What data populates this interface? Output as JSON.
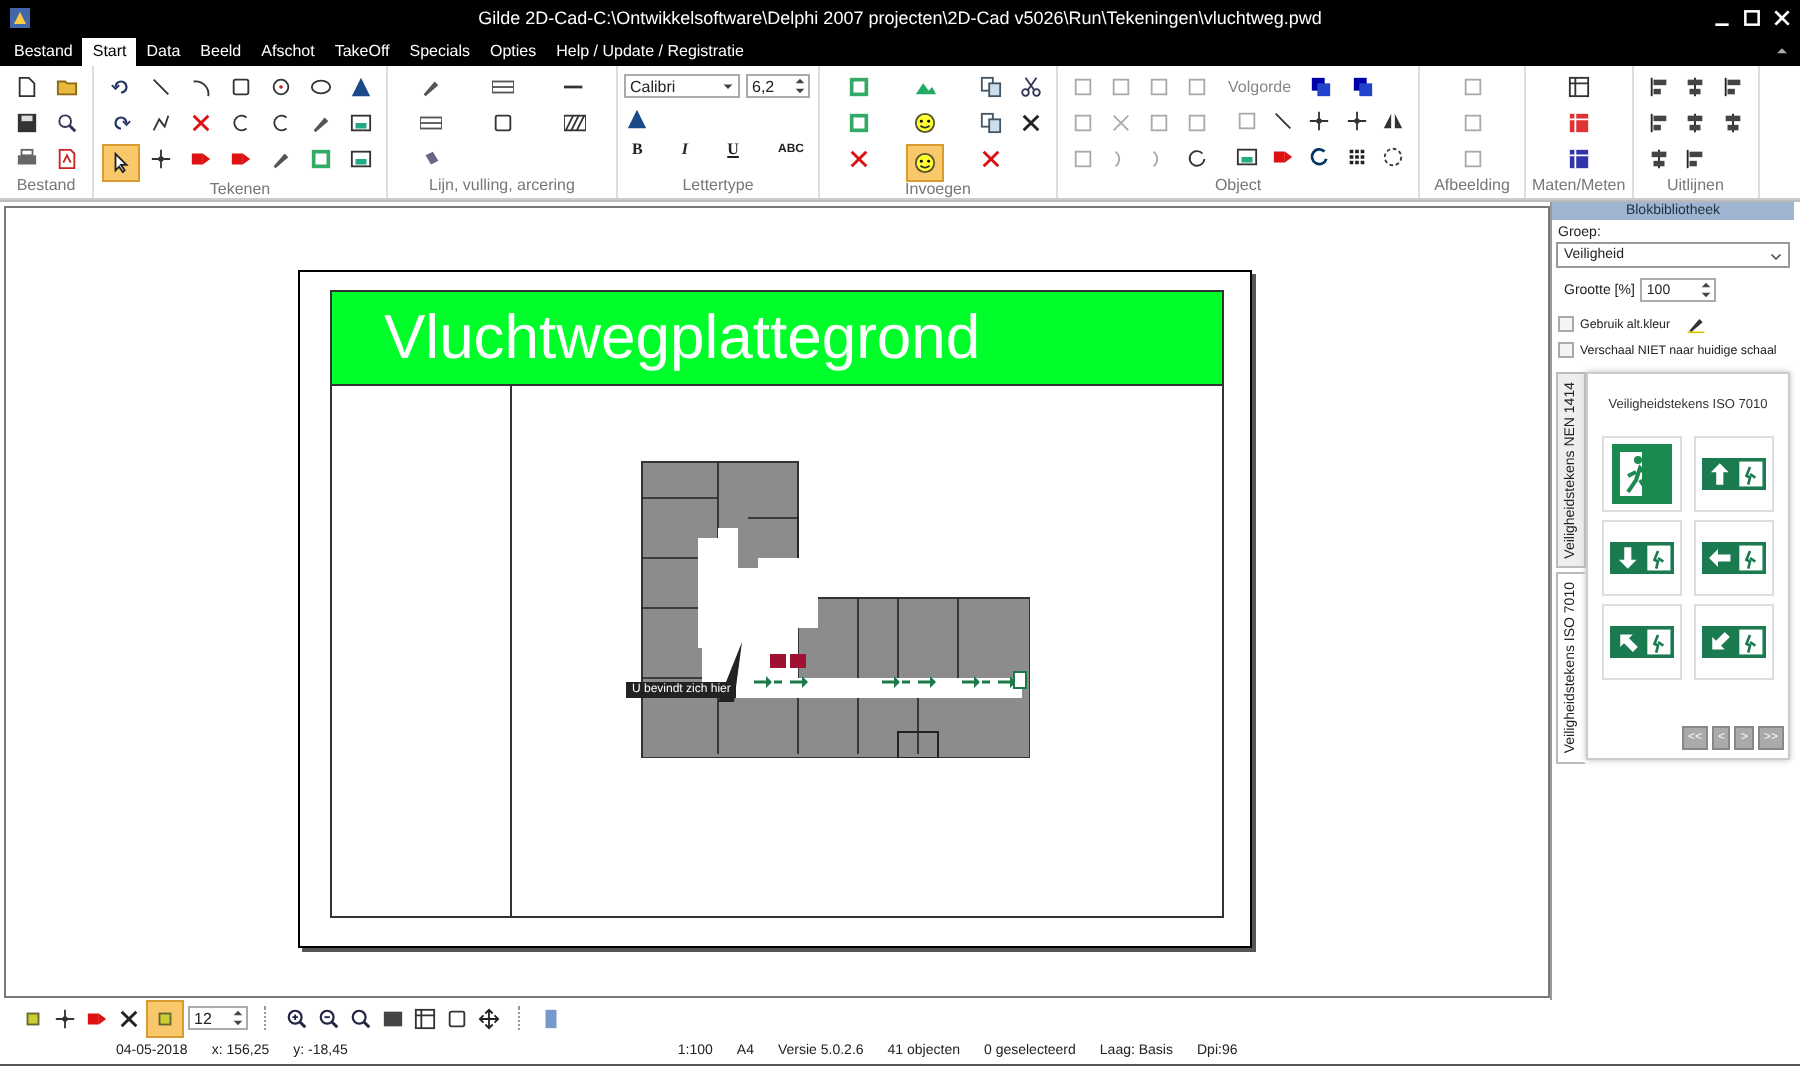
{
  "window": {
    "title": "Gilde  2D-Cad-C:\\Ontwikkelsoftware\\Delphi  2007  projecten\\2D-Cad  v5026\\Run\\Tekeningen\\vluchtweg.pwd"
  },
  "menu": [
    {
      "label": "Bestand",
      "selected": false
    },
    {
      "label": "Start",
      "selected": true
    },
    {
      "label": "Data",
      "selected": false
    },
    {
      "label": "Beeld",
      "selected": false
    },
    {
      "label": "Afschot",
      "selected": false
    },
    {
      "label": "TakeOff",
      "selected": false
    },
    {
      "label": "Specials",
      "selected": false
    },
    {
      "label": "Opties",
      "selected": false
    },
    {
      "label": "Help / Update / Registratie",
      "selected": false
    }
  ],
  "ribbon": {
    "groups": [
      {
        "kind": "bestand",
        "label": "Bestand"
      },
      {
        "kind": "tekenen",
        "label": "Tekenen",
        "pointer_selected": true
      },
      {
        "kind": "lijn",
        "label": "Lijn, vulling, arcering"
      },
      {
        "kind": "lettertype",
        "label": "Lettertype"
      },
      {
        "kind": "invoegen",
        "label": "Invoegen",
        "smiley_selected": true
      },
      {
        "kind": "object",
        "label": "Object",
        "order_label": "Volgorde"
      },
      {
        "kind": "afbeelding",
        "label": "Afbeelding"
      },
      {
        "kind": "maten",
        "label": "Maten/Meten"
      },
      {
        "kind": "uitlijnen",
        "label": "Uitlijnen"
      }
    ],
    "font": {
      "value": "Calibri"
    },
    "font_size": {
      "value": "6,2"
    },
    "format_buttons": [
      "B",
      "I",
      "U",
      "ABC"
    ]
  },
  "canvas": {
    "title": "Vluchtwegplattegrond",
    "callout": "U bevindt zich hier"
  },
  "panel": {
    "title": "Blokbibliotheek",
    "group_label": "Groep:",
    "group_value": "Veiligheid",
    "size_label": "Grootte [%]",
    "size_value": "100",
    "checkboxes": [
      {
        "label": "Gebruik alt.kleur",
        "checked": false
      },
      {
        "label": "Verschaal NIET naar huidige schaal",
        "checked": false
      }
    ],
    "tabs": [
      {
        "label": "Veiligheidstekens NEN 1414",
        "selected": false
      },
      {
        "label": "Veiligheidstekens ISO 7010",
        "selected": true
      }
    ],
    "page_title": "Veiligheidstekens ISO 7010",
    "signs": [
      {
        "kind": "running"
      },
      {
        "kind": "up"
      },
      {
        "kind": "down"
      },
      {
        "kind": "left"
      },
      {
        "kind": "upleft"
      },
      {
        "kind": "downleft"
      }
    ],
    "nav": [
      "<<",
      "<",
      ">",
      ">>"
    ]
  },
  "bottom_toolbar": {
    "snap_selected": true,
    "grid_value": "12"
  },
  "status_bar": {
    "left": [
      "04-05-2018",
      "x: 156,25",
      "y: -18,45"
    ],
    "right": [
      "1:100",
      "A4",
      "Versie 5.0.2.6",
      "41 objecten",
      "0 geselecteerd",
      "Laag: Basis",
      "Dpi:96"
    ]
  }
}
